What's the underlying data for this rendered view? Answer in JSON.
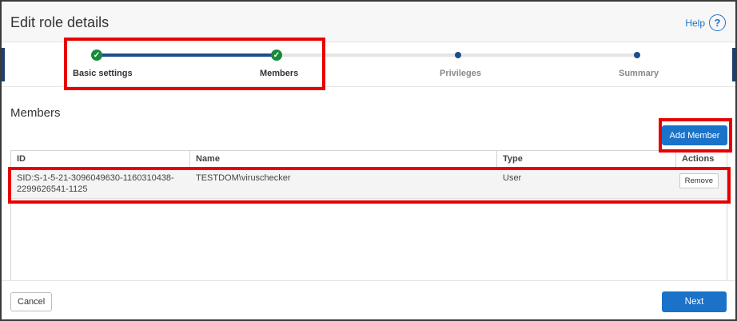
{
  "dialog": {
    "title": "Edit role details",
    "help_label": "Help",
    "help_icon_glyph": "?"
  },
  "steps": [
    {
      "label": "Basic settings",
      "status": "complete",
      "glyph": "✓"
    },
    {
      "label": "Members",
      "status": "complete",
      "glyph": "✓"
    },
    {
      "label": "Privileges",
      "status": "pending"
    },
    {
      "label": "Summary",
      "status": "pending"
    }
  ],
  "members": {
    "title": "Members",
    "add_button_label": "Add Member",
    "columns": [
      "ID",
      "Name",
      "Type",
      "Actions"
    ],
    "rows": [
      {
        "id_line1": "SID:S-1-5-21-3096049630-1160310438-",
        "id_line2": "2299626541-1125",
        "name": "TESTDOM\\viruschecker",
        "type": "User",
        "action_label": "Remove"
      }
    ]
  },
  "footer": {
    "cancel_label": "Cancel",
    "next_label": "Next"
  },
  "colors": {
    "accent": "#1a72c9",
    "step_complete": "#188a3a",
    "step_track_done": "#1d4d8c",
    "annotation": "#e80000"
  }
}
